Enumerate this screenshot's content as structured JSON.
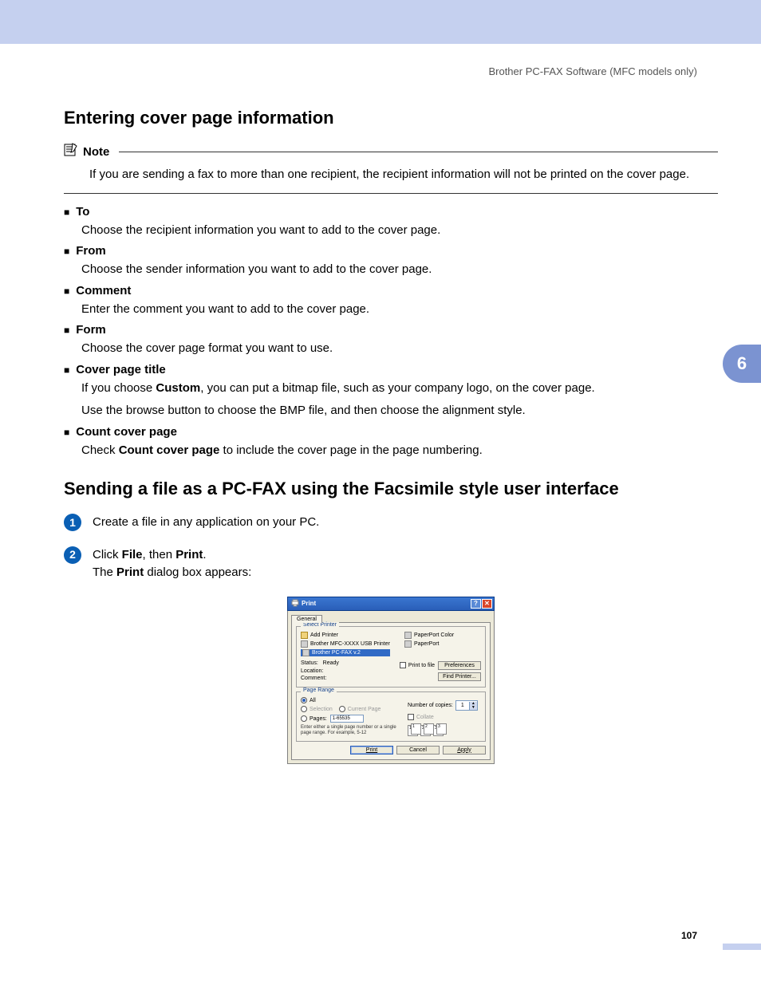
{
  "page": {
    "header_right": "Brother PC-FAX Software (MFC models only)",
    "side_tab": "6",
    "page_number": "107"
  },
  "section1": {
    "title": "Entering cover page information",
    "note_label": "Note",
    "note_text": "If you are sending a fax to more than one recipient, the recipient information will not be printed on the cover page.",
    "items": [
      {
        "title": "To",
        "desc": "Choose the recipient information you want to add to the cover page."
      },
      {
        "title": "From",
        "desc": "Choose the sender information you want to add to the cover page."
      },
      {
        "title": "Comment",
        "desc": "Enter the comment you want to add to the cover page."
      },
      {
        "title": "Form",
        "desc": "Choose the cover page format you want to use."
      }
    ],
    "cover_page_title": {
      "title": "Cover page title",
      "line1_a": "If you choose ",
      "line1_b": "Custom",
      "line1_c": ", you can put a bitmap file, such as your company logo, on the cover page.",
      "line2": "Use the browse button to choose the BMP file, and then choose the alignment style."
    },
    "count_cover_page": {
      "title": "Count cover page",
      "a": "Check ",
      "b": "Count cover page",
      "c": " to include the cover page in the page numbering."
    }
  },
  "section2": {
    "title": "Sending a file as a PC-FAX using the Facsimile style user interface",
    "step1": "Create a file in any application on your PC.",
    "step2": {
      "a": "Click ",
      "b": "File",
      "c": ", then ",
      "d": "Print",
      "e": ".",
      "f": "The ",
      "g": "Print",
      "h": " dialog box appears:"
    }
  },
  "dialog": {
    "title": "Print",
    "tab": "General",
    "grp_select_printer": "Select Printer",
    "printers_col1": [
      "Add Printer",
      "Brother MFC-XXXX USB Printer",
      "Brother PC-FAX v.2"
    ],
    "printers_col2": [
      "PaperPort Color",
      "PaperPort"
    ],
    "status_lbl": "Status:",
    "status_val": "Ready",
    "location_lbl": "Location:",
    "comment_lbl": "Comment:",
    "print_to_file": "Print to file",
    "preferences": "Preferences",
    "find_printer": "Find Printer...",
    "grp_page_range": "Page Range",
    "all": "All",
    "selection": "Selection",
    "current_page": "Current Page",
    "pages": "Pages:",
    "pages_val": "1-65535",
    "pages_hint": "Enter either a single page number or a single page range. For example, 5-12",
    "num_copies": "Number of copies:",
    "copies_val": "1",
    "collate": "Collate",
    "btn_print": "Print",
    "btn_cancel": "Cancel",
    "btn_apply": "Apply"
  }
}
